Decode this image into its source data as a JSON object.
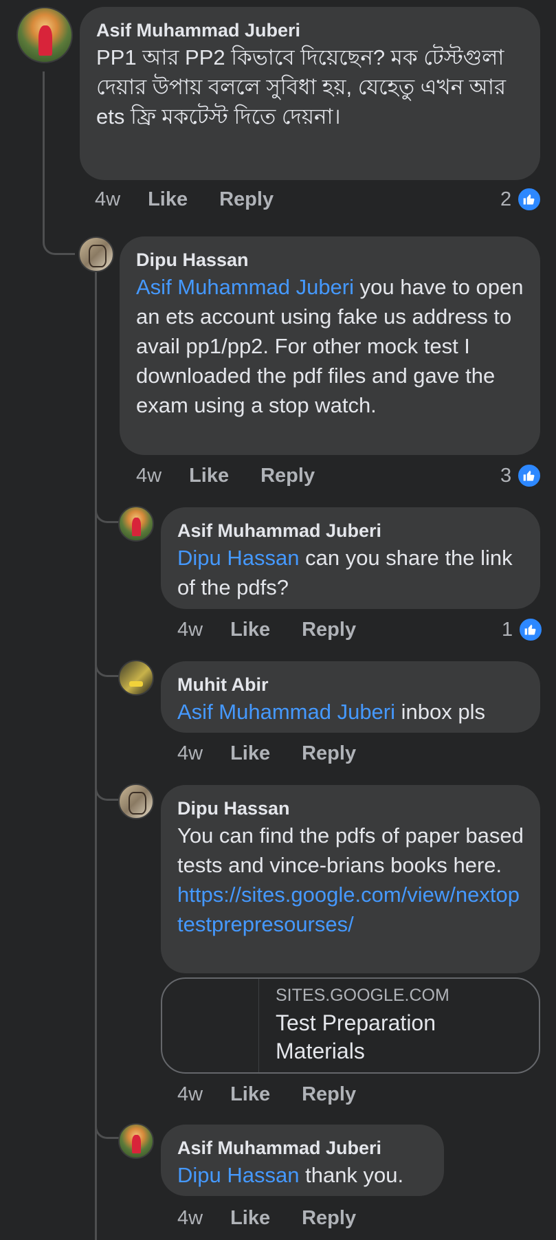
{
  "comments": [
    {
      "author": "Asif Muhammad Juberi",
      "text": "PP1 আর PP2 কিভাবে দিয়েছেন? মক টেস্টগুলা দেয়ার উপায় বললে সুবিধা হয়, যেহেতু এখন আর ets ফ্রি মকটেস্ট দিতে দেয়না।",
      "time": "4w",
      "like": "Like",
      "reply": "Reply",
      "reactions": "2"
    },
    {
      "author": "Dipu Hassan",
      "mention": "Asif Muhammad Juberi",
      "text": " you have to open an ets account using fake us address to avail pp1/pp2.  For other mock test I downloaded the pdf files and gave the exam using a stop watch.",
      "time": "4w",
      "like": "Like",
      "reply": "Reply",
      "reactions": "3"
    },
    {
      "author": "Asif Muhammad Juberi",
      "mention": "Dipu Hassan",
      "text": " can you share the link of the pdfs?",
      "time": "4w",
      "like": "Like",
      "reply": "Reply",
      "reactions": "1"
    },
    {
      "author": "Muhit Abir",
      "mention": "Asif Muhammad Juberi",
      "text": " inbox pls",
      "time": "4w",
      "like": "Like",
      "reply": "Reply"
    },
    {
      "author": "Dipu Hassan",
      "text": "You can find the pdfs of paper based tests and vince-brians books here.",
      "link": "https://sites.google.com/view/nextoptestprepresourses/",
      "time": "4w",
      "like": "Like",
      "reply": "Reply",
      "preview": {
        "domain": "SITES.GOOGLE.COM",
        "title": "Test Preparation Materials"
      }
    },
    {
      "author": "Asif Muhammad Juberi",
      "mention": "Dipu Hassan",
      "text": " thank you.",
      "time": "4w",
      "like": "Like",
      "reply": "Reply"
    }
  ],
  "icons": {
    "reaction": "thumbs-up-icon"
  },
  "colors": {
    "background": "#242526",
    "bubble": "#3a3b3c",
    "mention": "#4599ff",
    "reaction": "#2d88ff"
  }
}
